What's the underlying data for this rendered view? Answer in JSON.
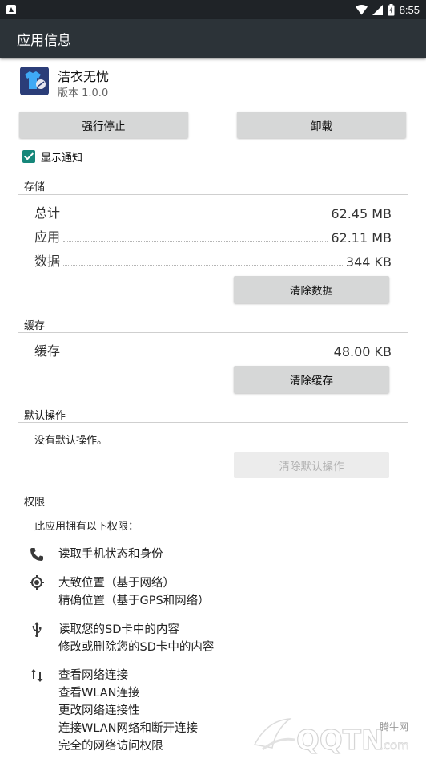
{
  "status_bar": {
    "time": "8:55"
  },
  "app_bar": {
    "title": "应用信息"
  },
  "app": {
    "name": "洁衣无忧",
    "version": "版本 1.0.0"
  },
  "buttons": {
    "force_stop": "强行停止",
    "uninstall": "卸载"
  },
  "notifications": {
    "label": "显示通知",
    "checked": true
  },
  "storage": {
    "header": "存储",
    "rows": [
      {
        "label": "总计",
        "value": "62.45 MB"
      },
      {
        "label": "应用",
        "value": "62.11 MB"
      },
      {
        "label": "数据",
        "value": "344 KB"
      }
    ],
    "clear_button": "清除数据"
  },
  "cache": {
    "header": "缓存",
    "rows": [
      {
        "label": "缓存",
        "value": "48.00 KB"
      }
    ],
    "clear_button": "清除缓存"
  },
  "defaults": {
    "header": "默认操作",
    "text": "没有默认操作。",
    "clear_button": "清除默认操作"
  },
  "permissions": {
    "header": "权限",
    "intro": "此应用拥有以下权限：",
    "groups": [
      {
        "icon": "phone-icon",
        "lines": [
          "读取手机状态和身份"
        ]
      },
      {
        "icon": "location-icon",
        "lines": [
          "大致位置（基于网络）",
          "精确位置（基于GPS和网络）"
        ]
      },
      {
        "icon": "usb-icon",
        "lines": [
          "读取您的SD卡中的内容",
          "修改或删除您的SD卡中的内容"
        ]
      },
      {
        "icon": "network-arrows-icon",
        "lines": [
          "查看网络连接",
          "查看WLAN连接",
          "更改网络连接性",
          "连接WLAN网络和断开连接",
          "完全的网络访问权限"
        ]
      }
    ]
  },
  "watermark": {
    "brand": "腾牛网",
    "logo_text": "QQTN",
    "suffix": ".com"
  }
}
